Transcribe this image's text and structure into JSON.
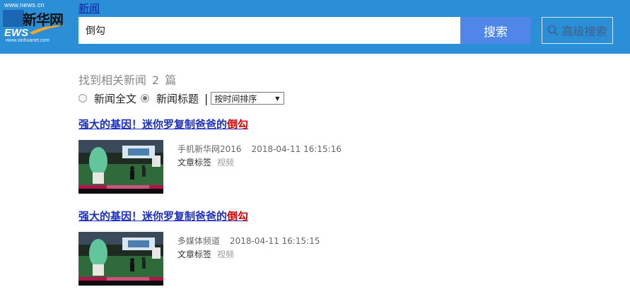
{
  "header": {
    "logo": {
      "url_text": "www.news.cn",
      "brand_cn": "新华网",
      "brand_en": "EWS",
      "sub_text": "www.xinhuanet.com"
    },
    "channel_link": "新闻",
    "search": {
      "query": "倒勾",
      "button_label": "搜索"
    },
    "advanced_label": "高级搜索"
  },
  "summary": {
    "prefix": "找到相关新闻",
    "count": "2",
    "suffix": "篇"
  },
  "filters": {
    "fulltext_label": "新闻全文",
    "title_label": "新闻标题",
    "separator": "|",
    "sort_selected": "按时间排序",
    "selected_option": "新闻标题"
  },
  "results": [
    {
      "title_text": "强大的基因！迷你罗复制爸爸的",
      "title_highlight": "倒勾",
      "source": "手机新华网2016",
      "datetime": "2018-04-11 16:15:16",
      "tag_label": "文章标签",
      "tag_value": "视频"
    },
    {
      "title_text": "强大的基因！迷你罗复制爸爸的",
      "title_highlight": "倒勾",
      "source": "多媒体频道",
      "datetime": "2018-04-11 16:15:15",
      "tag_label": "文章标签",
      "tag_value": "视频"
    }
  ],
  "colors": {
    "header_bg": "#2b8fd8",
    "search_button": "#4f86e8",
    "link": "#1c2fbf",
    "highlight": "#d60000"
  }
}
